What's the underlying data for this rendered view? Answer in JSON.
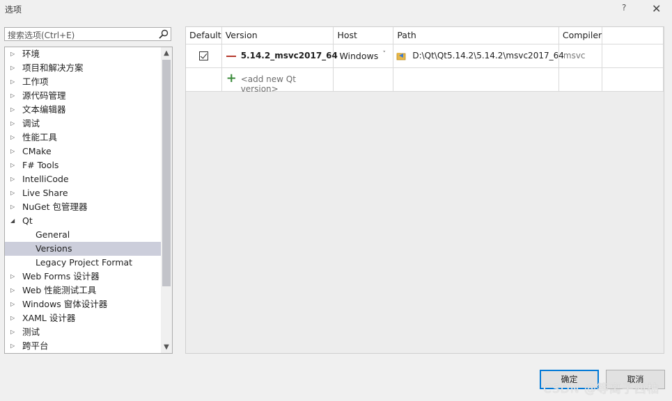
{
  "window": {
    "title": "选项",
    "help": "?",
    "close": "✕"
  },
  "search": {
    "placeholder": "搜索选项(Ctrl+E)"
  },
  "tree": {
    "items": [
      {
        "label": "环境",
        "arrow": "▷"
      },
      {
        "label": "项目和解决方案",
        "arrow": "▷"
      },
      {
        "label": "工作项",
        "arrow": "▷"
      },
      {
        "label": "源代码管理",
        "arrow": "▷"
      },
      {
        "label": "文本编辑器",
        "arrow": "▷"
      },
      {
        "label": "调试",
        "arrow": "▷"
      },
      {
        "label": "性能工具",
        "arrow": "▷"
      },
      {
        "label": "CMake",
        "arrow": "▷"
      },
      {
        "label": "F# Tools",
        "arrow": "▷"
      },
      {
        "label": "IntelliCode",
        "arrow": "▷"
      },
      {
        "label": "Live Share",
        "arrow": "▷"
      },
      {
        "label": "NuGet 包管理器",
        "arrow": "▷"
      },
      {
        "label": "Qt",
        "arrow": "◢"
      },
      {
        "label": "General",
        "arrow": ""
      },
      {
        "label": "Versions",
        "arrow": ""
      },
      {
        "label": "Legacy Project Format",
        "arrow": ""
      },
      {
        "label": "Web Forms 设计器",
        "arrow": "▷"
      },
      {
        "label": "Web 性能测试工具",
        "arrow": "▷"
      },
      {
        "label": "Windows 窗体设计器",
        "arrow": "▷"
      },
      {
        "label": "XAML 设计器",
        "arrow": "▷"
      },
      {
        "label": "测试",
        "arrow": "▷"
      },
      {
        "label": "跨平台",
        "arrow": "▷"
      }
    ],
    "selected": "Versions"
  },
  "table": {
    "headers": {
      "default": "Default",
      "version": "Version",
      "host": "Host",
      "path": "Path",
      "compiler": "Compiler"
    },
    "rows": [
      {
        "default_checked": true,
        "version": "5.14.2_msvc2017_64",
        "host": "Windows",
        "path": "D:\\Qt\\Qt5.14.2\\5.14.2\\msvc2017_64",
        "compiler": "msvc"
      }
    ],
    "add_row": {
      "label": "<add new Qt version>"
    }
  },
  "buttons": {
    "ok": "确定",
    "cancel": "取消"
  },
  "watermark": "CSDN @等离子西柚",
  "colors": {
    "selection": "#cccedb",
    "accent": "#0078d7",
    "version_marker": "#b5362a",
    "add_icon": "#3a8a3a"
  }
}
